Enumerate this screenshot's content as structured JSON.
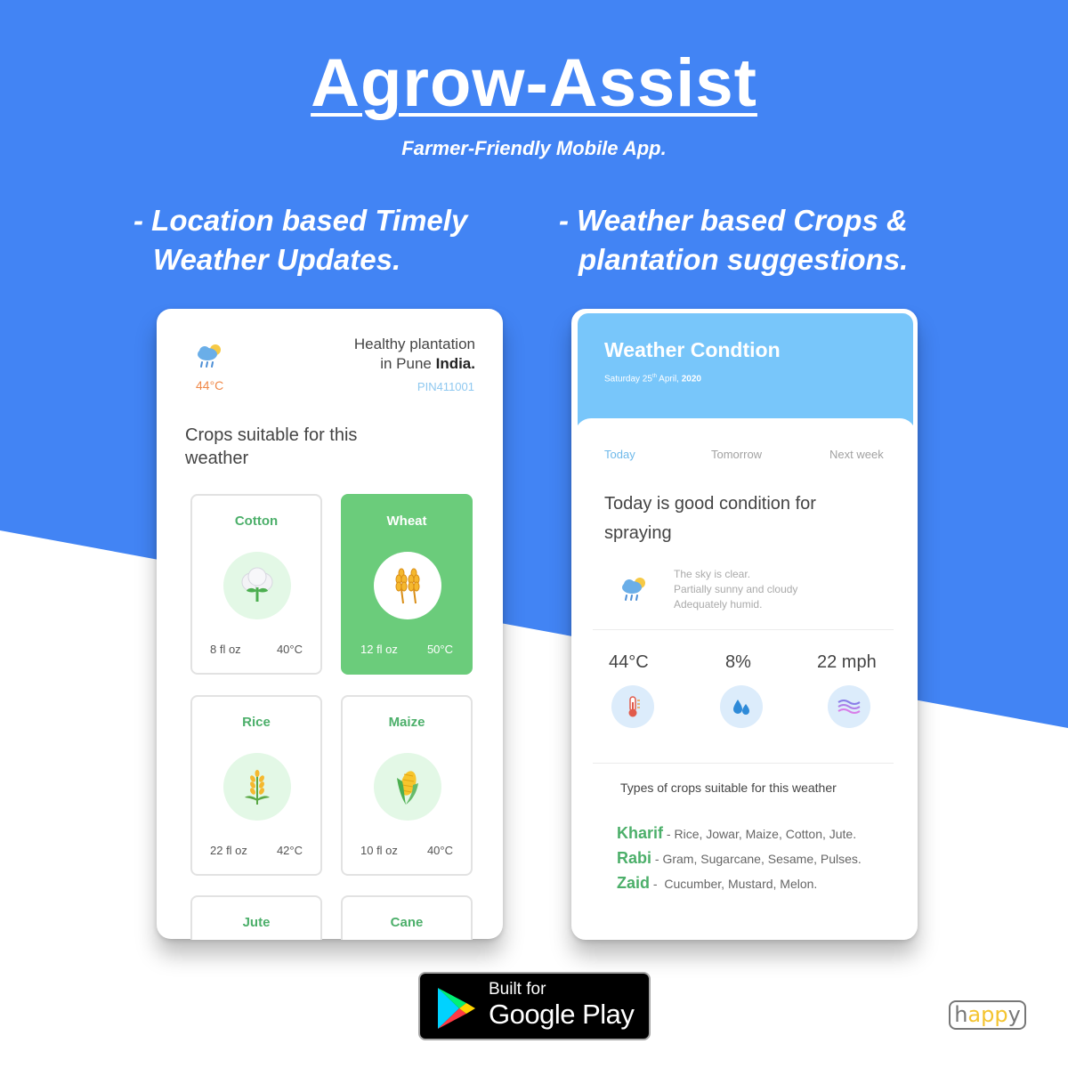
{
  "colors": {
    "hero_blue": "#4284f4",
    "accent_green": "#4caf6a",
    "active_card_green": "#6bcc7b",
    "header_blue": "#78c6fa",
    "temp_orange": "#f08a4b"
  },
  "hero": {
    "title": "Agrow-Assist",
    "subtitle": "Farmer-Friendly Mobile App.",
    "feature_left_line1": "- Location based Timely",
    "feature_left_line2": "Weather Updates.",
    "feature_right_line1": "- Weather based Crops &",
    "feature_right_line2": "plantation suggestions."
  },
  "left_screen": {
    "weather_icon": "sun-cloud-rain-icon",
    "temperature": "44°C",
    "location_line1": "Healthy plantation",
    "location_prefix": "in Pune ",
    "location_country": "India.",
    "pin": "PIN411001",
    "section_title": "Crops suitable for this weather",
    "crops": [
      {
        "name": "Cotton",
        "icon": "cotton-icon",
        "quantity": "8 fl oz",
        "temp": "40°C",
        "selected": false
      },
      {
        "name": "Wheat",
        "icon": "wheat-icon",
        "quantity": "12 fl oz",
        "temp": "50°C",
        "selected": true
      },
      {
        "name": "Rice",
        "icon": "rice-icon",
        "quantity": "22 fl oz",
        "temp": "42°C",
        "selected": false
      },
      {
        "name": "Maize",
        "icon": "maize-icon",
        "quantity": "10 fl oz",
        "temp": "40°C",
        "selected": false
      },
      {
        "name": "Jute",
        "icon": "",
        "quantity": "",
        "temp": "",
        "selected": false
      },
      {
        "name": "Cane",
        "icon": "",
        "quantity": "",
        "temp": "",
        "selected": false
      }
    ]
  },
  "right_screen": {
    "title": "Weather Condtion",
    "date_prefix": "Saturday 25",
    "date_sup": "th",
    "date_mid": " April, ",
    "date_year": "2020",
    "tabs": [
      "Today",
      "Tomorrow",
      "Next week"
    ],
    "condition": "Today is good condition for spraying",
    "weather_icon": "sun-cloud-rain-icon",
    "description": [
      "The sky is clear.",
      "Partially sunny and cloudy",
      "Adequately humid."
    ],
    "stats": [
      {
        "value": "44°C",
        "icon": "thermometer-icon"
      },
      {
        "value": "8%",
        "icon": "water-drops-icon"
      },
      {
        "value": "22 mph",
        "icon": "wind-waves-icon"
      }
    ],
    "crop_types_title": "Types of crops suitable for this weather",
    "seasons": [
      {
        "name": "Kharif",
        "sep": " - ",
        "crops": "Rice, Jowar, Maize, Cotton, Jute."
      },
      {
        "name": "Rabi",
        "sep": " - ",
        "crops": "Gram, Sugarcane, Sesame, Pulses."
      },
      {
        "name": "Zaid",
        "sep": " -  ",
        "crops": "Cucumber, Mustard, Melon."
      }
    ]
  },
  "store_badge": {
    "line1": "Built for",
    "line2": "Google Play",
    "icon": "google-play-icon"
  },
  "brand_logo": {
    "text_start": "h",
    "text_mid": "app",
    "text_end": "y"
  }
}
